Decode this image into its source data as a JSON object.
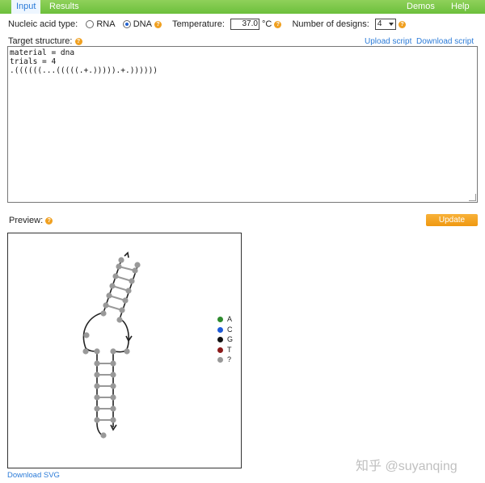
{
  "nav": {
    "tabs": [
      "Input",
      "Results"
    ],
    "right_links": [
      "Demos",
      "Help"
    ]
  },
  "form": {
    "nucleic_label": "Nucleic acid type:",
    "rna_label": "RNA",
    "dna_label": "DNA",
    "selected_type": "DNA",
    "temperature_label": "Temperature:",
    "temperature_value": "37.0",
    "temperature_unit": "°C",
    "designs_label": "Number of designs:",
    "designs_value": "4"
  },
  "target": {
    "label": "Target structure:",
    "upload_link": "Upload script",
    "download_link": "Download script",
    "script_lines": [
      "material = dna",
      "trials = 4",
      ".((((((...(((((.+.))))).+.))))))"
    ]
  },
  "preview": {
    "label": "Preview:",
    "update_button": "Update",
    "download_svg": "Download SVG"
  },
  "legend": [
    {
      "label": "A",
      "color": "#2e8b2e"
    },
    {
      "label": "C",
      "color": "#1e5ad8"
    },
    {
      "label": "G",
      "color": "#111111"
    },
    {
      "label": "T",
      "color": "#8b1a1a"
    },
    {
      "label": "?",
      "color": "#999999"
    }
  ],
  "watermark": "知乎 @suyanqing"
}
